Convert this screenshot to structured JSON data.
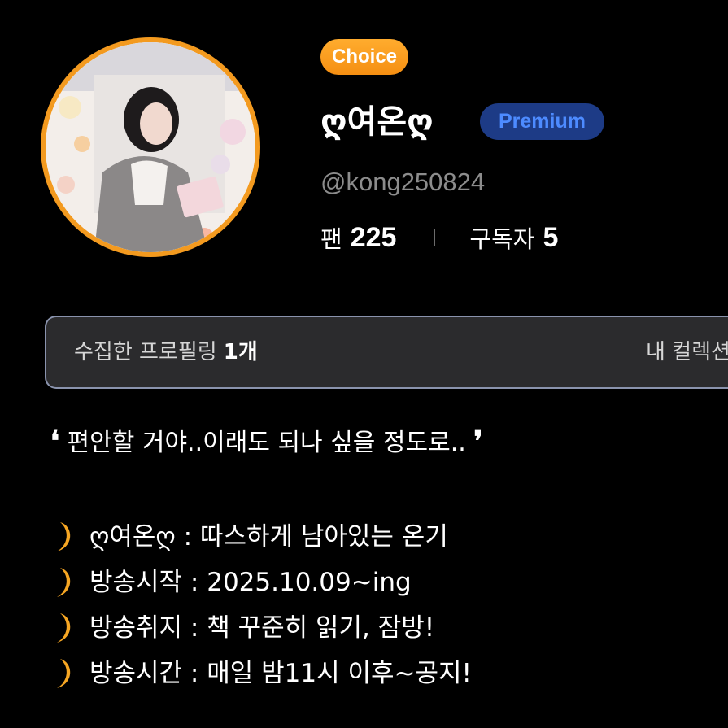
{
  "profile": {
    "avatar_alt": "profile photo",
    "choice_badge": "Choice",
    "nickname": "ღ여온ღ",
    "premium_badge": "Premium",
    "handle": "@kong250824",
    "stats": {
      "fans_label": "팬",
      "fans_count": "225",
      "subscribers_label": "구독자",
      "subscribers_count": "5"
    }
  },
  "collection": {
    "label": "수집한 프로필링",
    "count": "1개",
    "link_label": "내 컬렉션"
  },
  "bio": {
    "quote": "편안할 거야..이래도 되나 싶을 정도로..",
    "quote_open": "❛",
    "quote_close": "❜",
    "lines": [
      {
        "icon": "crescent-moon-icon",
        "text": "ღ여온ღ : 따스하게 남아있는 온기"
      },
      {
        "icon": "crescent-moon-icon",
        "text": "방송시작 : 2025.10.09~ing"
      },
      {
        "icon": "crescent-moon-icon",
        "text": "방송취지 : 책 꾸준히 읽기, 잠방!"
      },
      {
        "icon": "crescent-moon-icon",
        "text": "방송시간 : 매일 밤11시 이후~공지!"
      }
    ]
  },
  "colors": {
    "background": "#000000",
    "avatar_ring": "#f39a1f",
    "choice_badge": "#f7961a",
    "premium_bg": "#1d3b86",
    "premium_text": "#4d8bff",
    "handle_text": "#8c8c8c",
    "collection_bg": "#2b2b2d",
    "collection_border": "#8a93ad",
    "moon": "#f6a623"
  }
}
